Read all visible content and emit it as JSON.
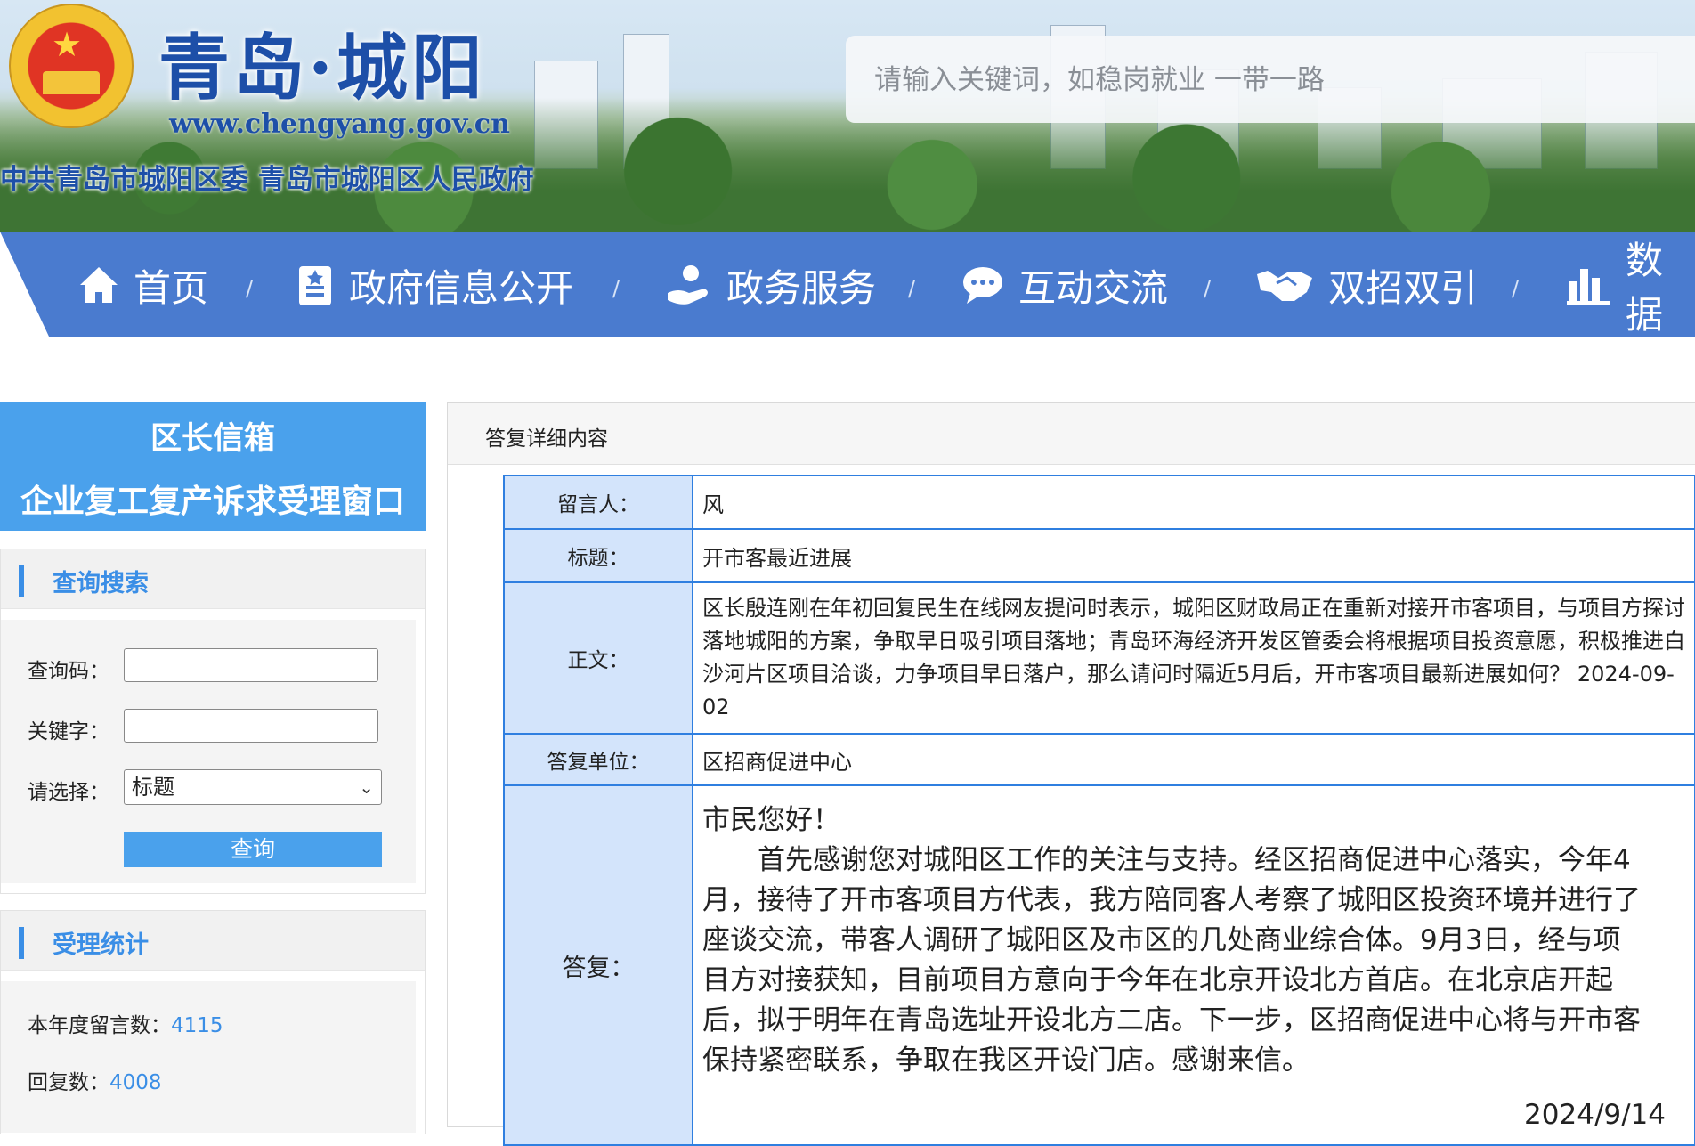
{
  "header": {
    "site_title": "青岛·城阳",
    "site_url": "www.chengyang.gov.cn",
    "site_subtitle": "中共青岛市城阳区委  青岛市城阳区人民政府",
    "search_placeholder": "请输入关键词，如稳岗就业 一带一路"
  },
  "nav": {
    "items": [
      {
        "label": "首页",
        "icon": "home-icon"
      },
      {
        "label": "政府信息公开",
        "icon": "document-icon"
      },
      {
        "label": "政务服务",
        "icon": "hand-service-icon"
      },
      {
        "label": "互动交流",
        "icon": "chat-icon"
      },
      {
        "label": "双招双引",
        "icon": "handshake-icon"
      },
      {
        "label": "数据",
        "icon": "bar-chart-icon"
      }
    ],
    "separator": "/"
  },
  "sidebar": {
    "title_line1": "区长信箱",
    "title_line2": "企业复工复产诉求受理窗口",
    "search_panel": {
      "heading": "查询搜索",
      "code_label": "查询码：",
      "keyword_label": "关键字：",
      "select_label": "请选择：",
      "select_value": "标题",
      "query_button": "查询"
    },
    "stats_panel": {
      "heading": "受理统计",
      "year_messages_label": "本年度留言数：",
      "year_messages_value": "4115",
      "replies_label": "回复数：",
      "replies_value": "4008"
    }
  },
  "main": {
    "heading": "答复详细内容",
    "fields": {
      "author_label": "留言人：",
      "author": "风",
      "title_label": "标题：",
      "title": "开市客最近进展",
      "body_label": "正文：",
      "body": "区长殷连刚在年初回复民生在线网友提问时表示，城阳区财政局正在重新对接开市客项目，与项目方探讨落地城阳的方案，争取早日吸引项目落地；青岛环海经济开发区管委会将根据项目投资意愿，积极推进白沙河片区项目洽谈，力争项目早日落户，那么请问时隔近5月后，开市客项目最新进展如何？  2024-09-02",
      "unit_label": "答复单位：",
      "unit": "区招商促进中心",
      "reply_label": "答复：",
      "reply_greeting": "市民您好！",
      "reply_body": "首先感谢您对城阳区工作的关注与支持。经区招商促进中心落实，今年4月，接待了开市客项目方代表，我方陪同客人考察了城阳区投资环境并进行了座谈交流，带客人调研了城阳区及市区的几处商业综合体。9月3日，经与项目方对接获知，目前项目方意向于今年在北京开设北方首店。在北京店开起后，拟于明年在青岛选址开设北方二店。下一步，区招商促进中心将与开市客保持紧密联系，争取在我区开设门店。感谢来信。",
      "reply_date": "2024/9/14"
    }
  },
  "colors": {
    "nav_bg": "#4a7bcf",
    "sidebar_title_bg": "#4aa1ec",
    "accent": "#3a8ee6",
    "table_border": "#2f7fe0",
    "table_key_bg": "#d3e4fb"
  }
}
